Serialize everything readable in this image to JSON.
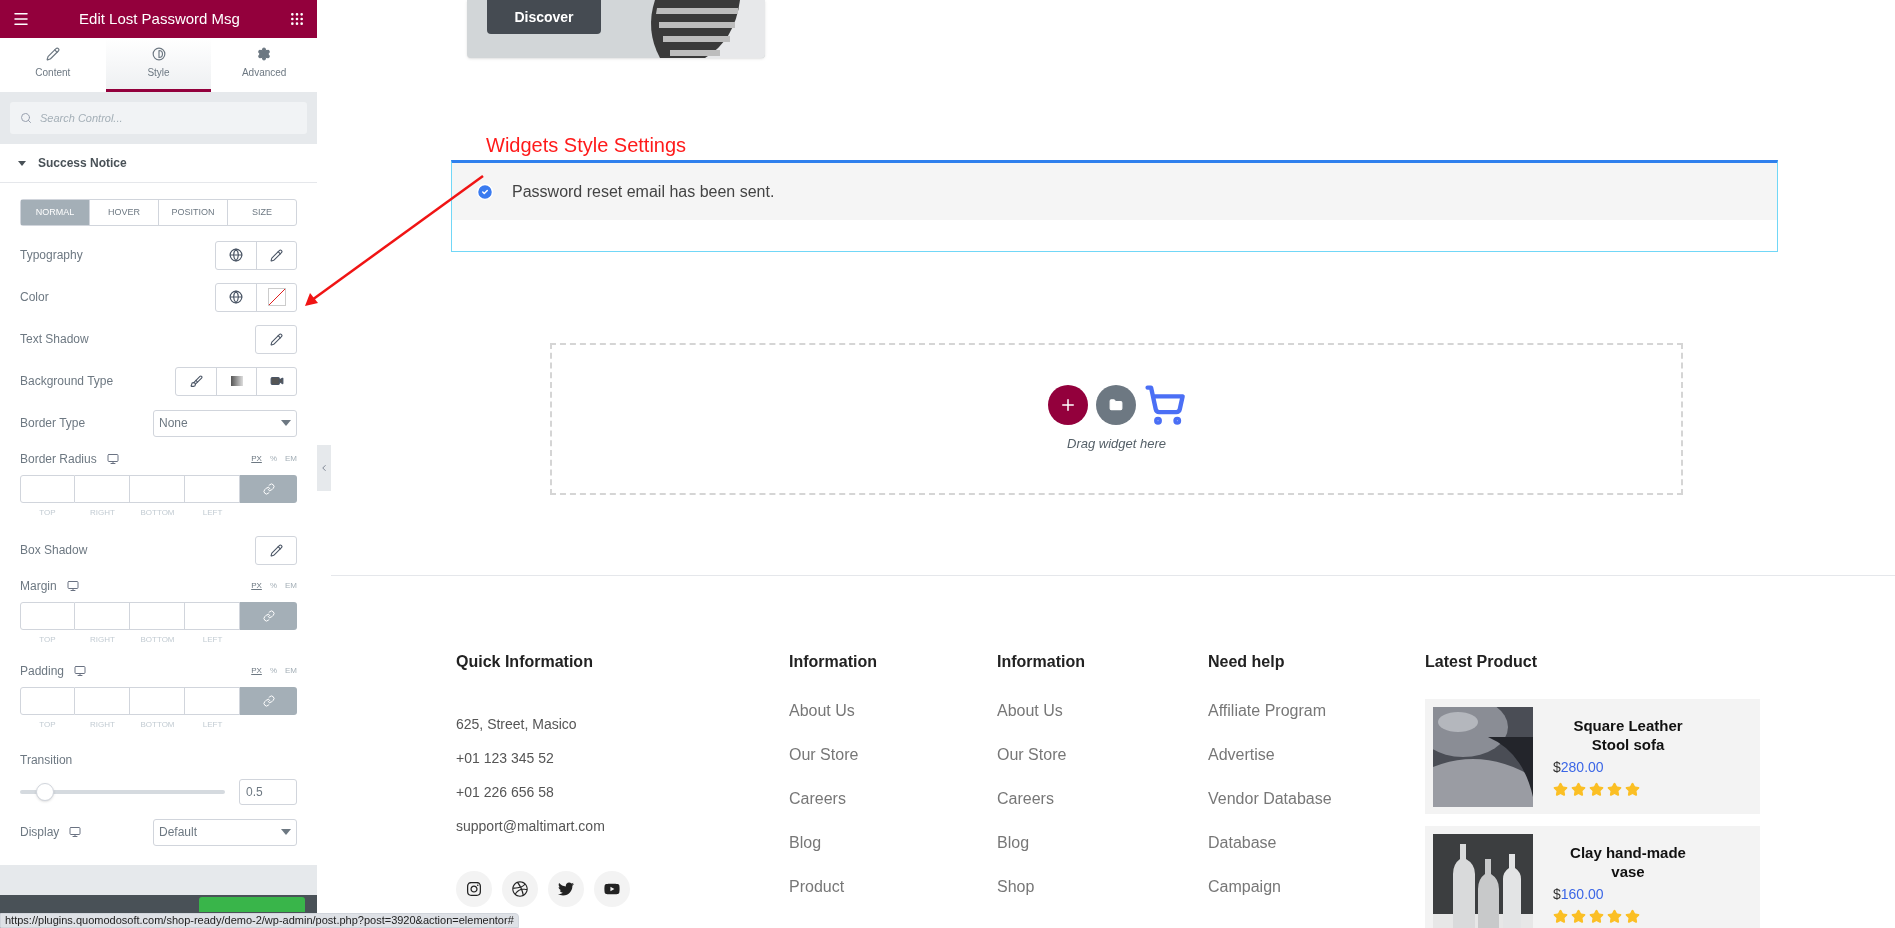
{
  "panel": {
    "title": "Edit Lost Password Msg",
    "tabs": [
      {
        "label": "Content",
        "selected": false
      },
      {
        "label": "Style",
        "selected": true
      },
      {
        "label": "Advanced",
        "selected": false
      }
    ],
    "search": {
      "placeholder": "Search Control..."
    },
    "section": {
      "title": "Success Notice",
      "expanded": true
    },
    "state_tabs": [
      {
        "label": "NORMAL",
        "selected": true
      },
      {
        "label": "HOVER",
        "selected": false
      },
      {
        "label": "POSITION",
        "selected": false
      },
      {
        "label": "SIZE",
        "selected": false
      }
    ],
    "controls": [
      {
        "kind": "typography",
        "label": "Typography"
      },
      {
        "kind": "color",
        "label": "Color"
      },
      {
        "kind": "edit",
        "label": "Text Shadow"
      },
      {
        "kind": "background",
        "label": "Background Type"
      },
      {
        "kind": "select",
        "label": "Border Type",
        "value": "None",
        "responsive": false
      },
      {
        "kind": "dimensions",
        "label": "Border Radius",
        "responsive": true,
        "units": [
          {
            "label": "PX",
            "selected": true
          },
          {
            "label": "%",
            "selected": false
          },
          {
            "label": "EM",
            "selected": false
          }
        ],
        "sides": [
          "TOP",
          "RIGHT",
          "BOTTOM",
          "LEFT"
        ]
      },
      {
        "kind": "edit",
        "label": "Box Shadow"
      },
      {
        "kind": "dimensions",
        "label": "Margin",
        "responsive": true,
        "units": [
          {
            "label": "PX",
            "selected": true
          },
          {
            "label": "%",
            "selected": false
          },
          {
            "label": "EM",
            "selected": false
          }
        ],
        "sides": [
          "TOP",
          "RIGHT",
          "BOTTOM",
          "LEFT"
        ]
      },
      {
        "kind": "dimensions",
        "label": "Padding",
        "responsive": true,
        "units": [
          {
            "label": "PX",
            "selected": true
          },
          {
            "label": "%",
            "selected": false
          },
          {
            "label": "EM",
            "selected": false
          }
        ],
        "sides": [
          "TOP",
          "RIGHT",
          "BOTTOM",
          "LEFT"
        ]
      },
      {
        "kind": "slider",
        "label": "Transition",
        "level": 0.12,
        "value": "0.5"
      },
      {
        "kind": "select",
        "label": "Display",
        "value": "Default",
        "responsive": true
      }
    ]
  },
  "canvas": {
    "promo_button": "Discover",
    "annotation": "Widgets Style Settings",
    "notice": {
      "text": "Password reset email has been sent."
    },
    "drop_zone": {
      "text": "Drag widget here"
    }
  },
  "footer": {
    "contact": {
      "title": "Quick Information",
      "lines": [
        "625, Street, Masico",
        "+01 123 345 52",
        "+01 226 656 58",
        "support@maltimart.com"
      ]
    },
    "columns": [
      {
        "title": "Information",
        "links": [
          "About Us",
          "Our Store",
          "Careers",
          "Blog",
          "Product"
        ]
      },
      {
        "title": "Information",
        "links": [
          "About Us",
          "Our Store",
          "Careers",
          "Blog",
          "Shop"
        ]
      },
      {
        "title": "Need help",
        "links": [
          "Affiliate Program",
          "Advertise",
          "Vendor Database",
          "Database",
          "Campaign"
        ]
      }
    ],
    "products": {
      "title": "Latest Product",
      "items": [
        {
          "name": "Square Leather Stool sofa",
          "currency": "$",
          "amount": "280.00",
          "stars": 5
        },
        {
          "name": "Clay hand-made vase",
          "currency": "$",
          "amount": "160.00",
          "stars": 5
        }
      ]
    }
  },
  "status_bar": {
    "url": "https://plugins.quomodosoft.com/shop-ready/demo-2/wp-admin/post.php?post=3920&action=elementor#"
  }
}
